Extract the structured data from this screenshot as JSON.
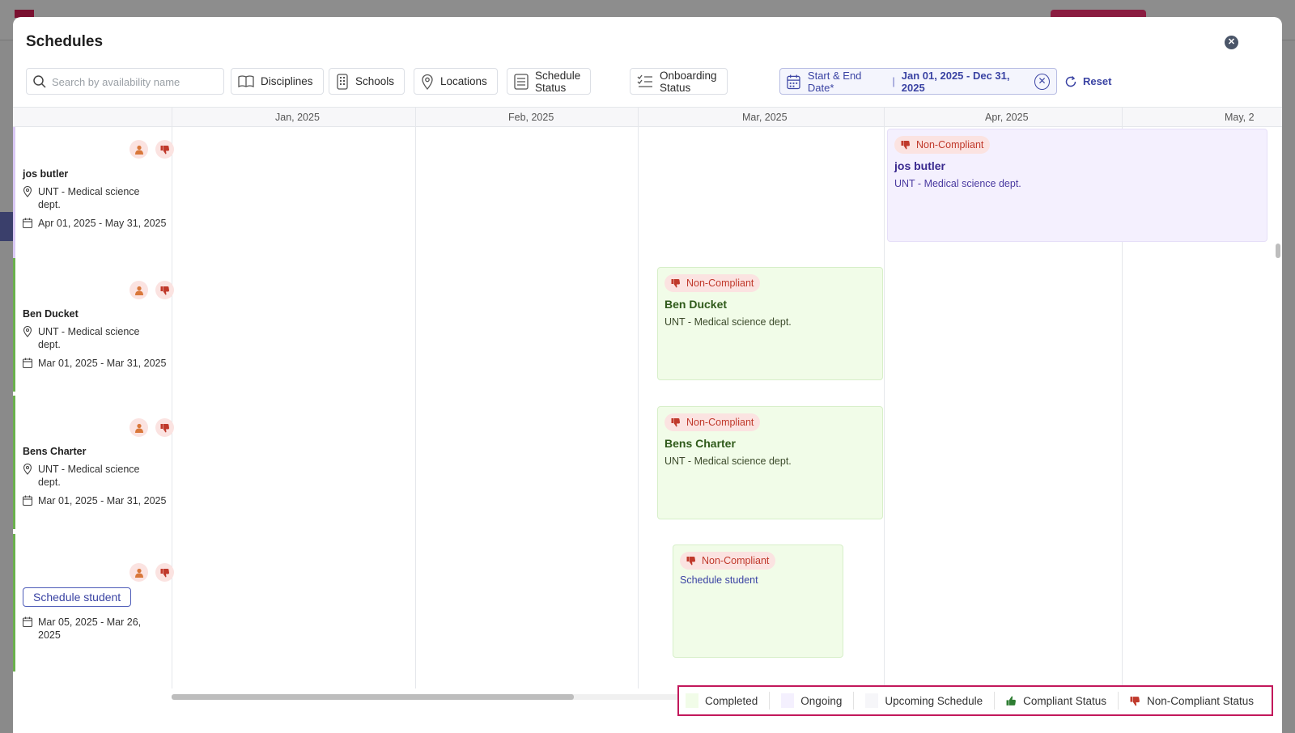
{
  "modal": {
    "title": "Schedules"
  },
  "filters": {
    "search_placeholder": "Search by availability name",
    "disciplines": "Disciplines",
    "schools": "Schools",
    "locations": "Locations",
    "schedule_status": "Schedule Status",
    "onboarding_status": "Onboarding Status",
    "date_label": "Start & End Date*",
    "date_separator": "|",
    "date_value": "Jan 01, 2025 - Dec 31, 2025",
    "reset": "Reset"
  },
  "months": [
    "Jan, 2025",
    "Feb, 2025",
    "Mar, 2025",
    "Apr, 2025",
    "May, 2"
  ],
  "rows": [
    {
      "name": "jos butler",
      "location": "UNT - Medical science dept.",
      "dates": "Apr 01, 2025 - May 31, 2025",
      "status_color": "#d9c8f5"
    },
    {
      "name": "Ben Ducket",
      "location": "UNT - Medical science dept.",
      "dates": "Mar 01, 2025 - Mar 31, 2025",
      "status_color": "#6ab04c"
    },
    {
      "name": "Bens  Charter",
      "location": "UNT - Medical science dept.",
      "dates": "Mar 01, 2025 - Mar 31, 2025",
      "status_color": "#6ab04c"
    },
    {
      "chip": "Schedule student",
      "dates": "Mar 05, 2025 - Mar 26, 2025",
      "status_color": "#6ab04c"
    }
  ],
  "events": [
    {
      "badge": "Non-Compliant",
      "title": "jos butler",
      "subtitle": "UNT - Medical science dept.",
      "status": "ongoing"
    },
    {
      "badge": "Non-Compliant",
      "title": "Ben Ducket",
      "subtitle": "UNT - Medical science dept.",
      "status": "completed"
    },
    {
      "badge": "Non-Compliant",
      "title": "Bens  Charter",
      "subtitle": "UNT - Medical science dept.",
      "status": "completed"
    },
    {
      "badge": "Non-Compliant",
      "subtitle": "Schedule student",
      "status": "completed"
    }
  ],
  "legend": {
    "completed": "Completed",
    "ongoing": "Ongoing",
    "upcoming": "Upcoming Schedule",
    "compliant": "Compliant Status",
    "non_compliant": "Non-Compliant Status"
  },
  "colors": {
    "completed": "#f1fce8",
    "ongoing": "#f4f0fe",
    "upcoming": "#f6f6f9",
    "accent": "#3a43a3",
    "legend_border": "#c2185b",
    "non_compliant_red": "#c0392b",
    "compliant_green": "#2e7d32"
  },
  "icons": {
    "close": "close-icon",
    "search": "search-icon",
    "disciplines": "book-open-icon",
    "schools": "building-icon",
    "locations": "map-pin-icon",
    "schedule_status": "list-icon",
    "onboarding_status": "checklist-icon",
    "date": "calendar-icon",
    "reset": "refresh-icon",
    "person": "person-icon",
    "thumbs_down": "thumbs-down-icon",
    "thumbs_up": "thumbs-up-icon"
  }
}
